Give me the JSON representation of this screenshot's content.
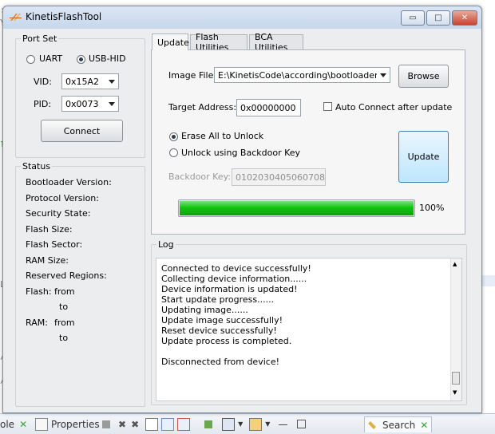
{
  "window": {
    "title": "KinetisFlashTool"
  },
  "port_set": {
    "title": "Port Set",
    "uart_label": "UART",
    "usb_hid_label": "USB-HID",
    "selected": "USB-HID",
    "vid_label": "VID:",
    "vid_value": "0x15A2",
    "pid_label": "PID:",
    "pid_value": "0x0073",
    "connect_label": "Connect"
  },
  "status": {
    "title": "Status",
    "bootloader_version": "Bootloader Version:",
    "protocol_version": "Protocol Version:",
    "security_state": "Security State:",
    "flash_size": "Flash Size:",
    "flash_sector": "Flash Sector:",
    "ram_size": "RAM Size:",
    "reserved_regions": "Reserved Regions:",
    "flash_label": "Flash:",
    "ram_label": "RAM:",
    "from_label": "from",
    "to_label": "to"
  },
  "tabs": [
    "Update",
    "Flash Utilities",
    "BCA Utilities"
  ],
  "update": {
    "image_file_label": "Image File:",
    "image_file_value": "E:\\KinetisCode\\according\\bootloader\\NXP_Kine",
    "browse_label": "Browse",
    "target_address_label": "Target Address:",
    "target_address_value": "0x00000000",
    "auto_connect_label": "Auto Connect after update",
    "erase_all_label": "Erase All to Unlock",
    "unlock_backdoor_label": "Unlock using Backdoor Key",
    "backdoor_key_label": "Backdoor Key:",
    "backdoor_key_value": "0102030405060708",
    "update_button_label": "Update",
    "progress_percent": 100,
    "progress_text": "100%"
  },
  "log": {
    "title": "Log",
    "lines": [
      "Connected to device successfully!",
      "Collecting device information......",
      "Device information is updated!",
      "Start update progress......",
      "Updating image......",
      "Update image successfully!",
      "Reset device successfully!",
      "Update process is completed.",
      "",
      "Disconnected from device!"
    ]
  },
  "ide": {
    "bottom_tabs": [
      "ole",
      "Properties",
      "Search"
    ]
  }
}
